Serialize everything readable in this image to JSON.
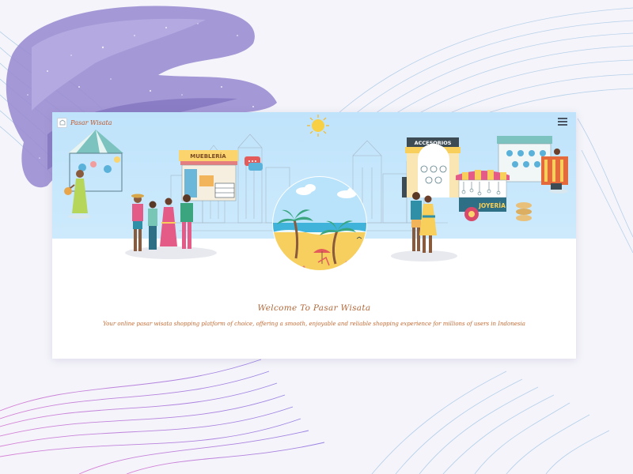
{
  "app": {
    "brand_name": "Pasar Wisata",
    "menu_icon": "hamburger-menu-icon"
  },
  "hero": {
    "signs": {
      "muebleria": "MUEBLERÍA",
      "accesorios": "ACCESORIOS",
      "joyeria": "JOYERÍA"
    }
  },
  "welcome": {
    "title": "Welcome To Pasar Wisata",
    "description": "Your online pasar wisata shopping platform of choice, offering a smooth, enjoyable and reliable shopping experience for millions of users in Indonesia"
  },
  "colors": {
    "sky": "#bfe3fb",
    "title_text": "#b0683a",
    "body_text": "#c46a33",
    "background_accent": "#8a7fc7"
  }
}
